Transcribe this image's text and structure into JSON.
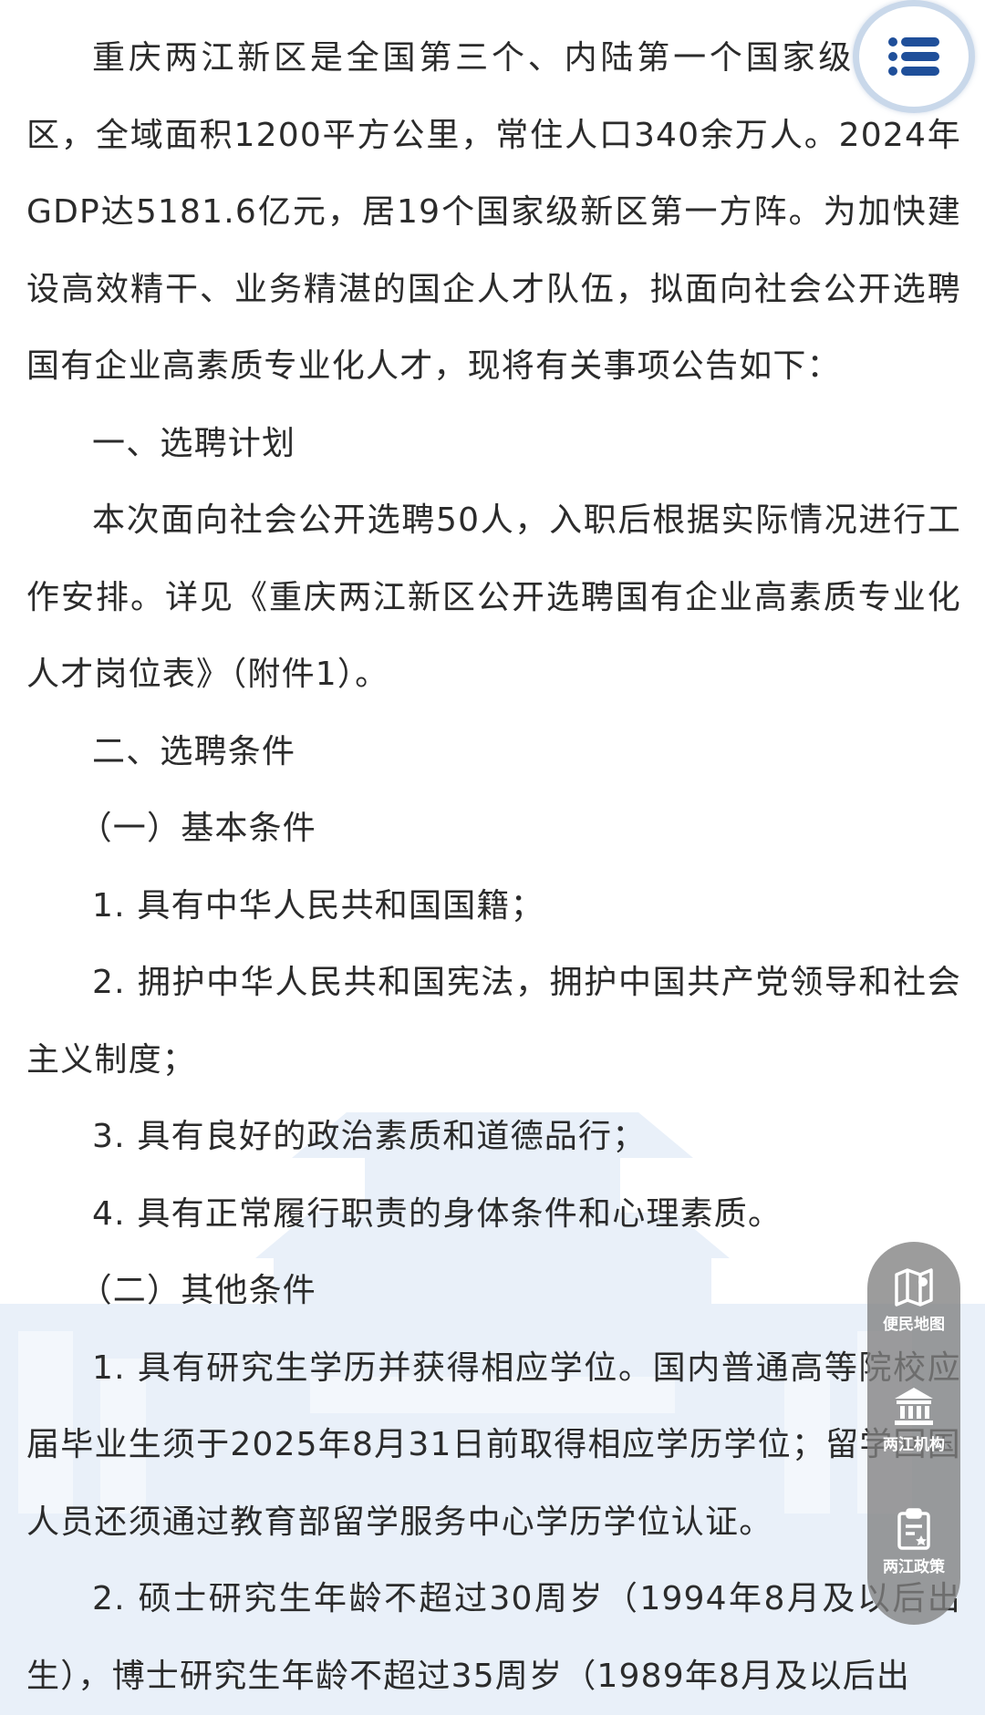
{
  "article": {
    "paragraphs": [
      "重庆两江新区是全国第三个、内陆第一个国家级开放新区，全域面积1200平方公里，常住人口340余万人。2024年GDP达5181.6亿元，居19个国家级新区第一方阵。为加快建设高效精干、业务精湛的国企人才队伍，拟面向社会公开选聘国有企业高素质专业化人才，现将有关事项公告如下：",
      "一、选聘计划",
      "本次面向社会公开选聘50人，入职后根据实际情况进行工作安排。详见《重庆两江新区公开选聘国有企业高素质专业化人才岗位表》（附件1）。",
      "二、选聘条件",
      "（一）基本条件",
      "1. 具有中华人民共和国国籍；",
      "2. 拥护中华人民共和国宪法，拥护中国共产党领导和社会主义制度；",
      "3. 具有良好的政治素质和道德品行；",
      "4. 具有正常履行职责的身体条件和心理素质。",
      "（二）其他条件",
      "1. 具有研究生学历并获得相应学位。国内普通高等院校应届毕业生须于2025年8月31日前取得相应学历学位；留学回国人员还须通过教育部留学服务中心学历学位认证。",
      "2. 硕士研究生年龄不超过30周岁（1994年8月及以后出生），博士研究生年龄不超过35周岁（1989年8月及以后出"
    ]
  },
  "menu_fab": {
    "icon": "list-menu-icon"
  },
  "side_dock": {
    "items": [
      {
        "label": "便民地图",
        "icon": "map-icon"
      },
      {
        "label": "两江机构",
        "icon": "institution-building-icon"
      },
      {
        "label": "两江政策",
        "icon": "policy-document-icon"
      }
    ]
  },
  "colors": {
    "text": "#2b2b2b",
    "menu_icon": "#1f4f9a",
    "menu_ring": "#c9d8ea",
    "dock_bg": "#808080",
    "watermark": "#e6eef8"
  }
}
